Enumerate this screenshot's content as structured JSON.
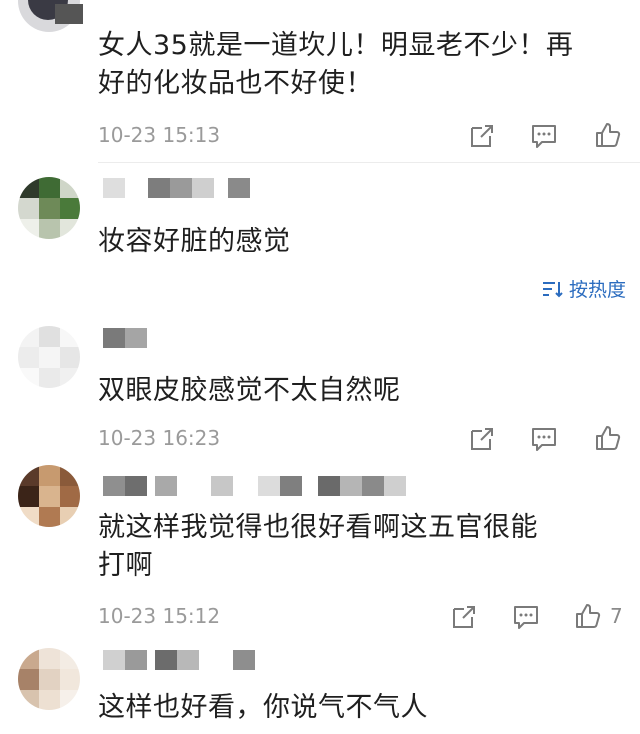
{
  "comments": [
    {
      "text_line1": "女人35就是一道坎儿！明显老不少！再",
      "text_line2": "好的化妆品也不好使！",
      "time": "10-23 15:13"
    },
    {
      "text_line1": "妆容好脏的感觉"
    },
    {
      "text_line1": "双眼皮胶感觉不太自然呢",
      "time": "10-23 16:23"
    },
    {
      "text_line1": "就这样我觉得也很好看啊这五官很能",
      "text_line2": "打啊",
      "time": "10-23 15:12",
      "like_count": "7"
    },
    {
      "text_line1": "这样也好看，你说气不气人"
    }
  ],
  "sort": {
    "label": "按热度"
  },
  "colors": {
    "accent": "#2b6cbf",
    "muted": "#9a9a9a"
  }
}
